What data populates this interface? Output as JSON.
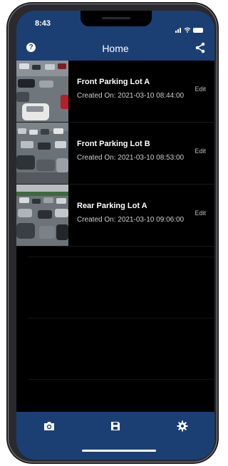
{
  "status_bar": {
    "time": "8:43",
    "icons": [
      "signal-icon",
      "wifi-icon",
      "battery-icon"
    ]
  },
  "header": {
    "title": "Home",
    "left_icon": "help-icon",
    "right_icon": "share-icon",
    "help_glyph": "?"
  },
  "lots": [
    {
      "name": "Front Parking Lot A",
      "created": "Created On: 2021-03-10 08:44:00",
      "edit_label": "Edit"
    },
    {
      "name": "Front Parking Lot B",
      "created": "Created On: 2021-03-10 08:53:00",
      "edit_label": "Edit"
    },
    {
      "name": "Rear Parking Lot A",
      "created": "Created On: 2021-03-10 09:06:00",
      "edit_label": "Edit"
    }
  ],
  "tab_bar": {
    "items": [
      "camera-icon",
      "save-icon",
      "settings-icon"
    ]
  },
  "colors": {
    "brand": "#1c3f73",
    "background": "#000000",
    "text": "#ffffff"
  }
}
